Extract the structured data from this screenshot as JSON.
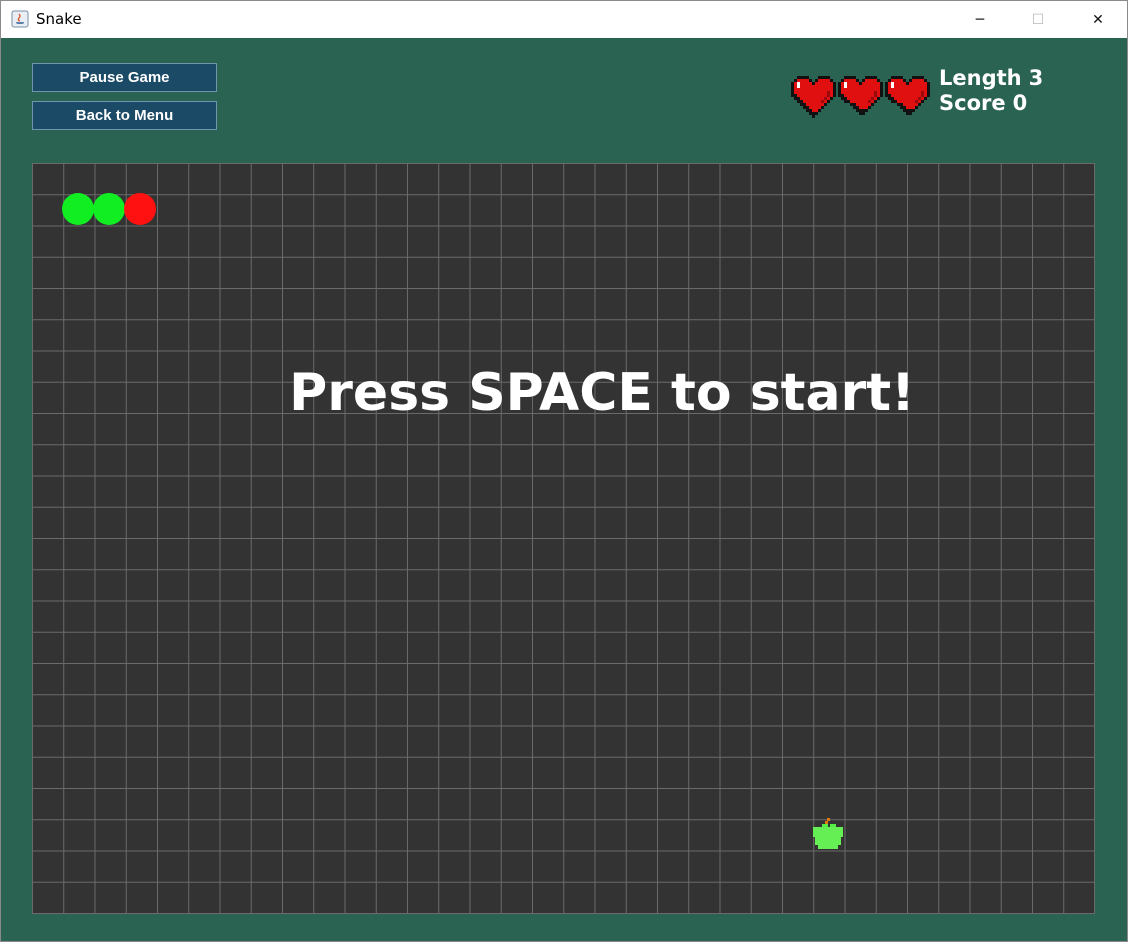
{
  "window": {
    "title": "Snake",
    "controls": {
      "minimize": "─",
      "maximize": "☐",
      "close": "✕"
    }
  },
  "buttons": {
    "pause": "Pause Game",
    "menu": "Back to Menu"
  },
  "status": {
    "lives": 3,
    "length_label": "Length",
    "length_value": "3",
    "score_label": "Score",
    "score_value": "0"
  },
  "board": {
    "message": "Press SPACE to start!",
    "snake_colors": {
      "body": "#11ee22",
      "head": "#ff1111"
    },
    "apple_icon": "apple-icon"
  },
  "colors": {
    "background": "#2a6352",
    "board": "#333333",
    "grid": "#6b6b6b",
    "button": "#1b4a66"
  }
}
